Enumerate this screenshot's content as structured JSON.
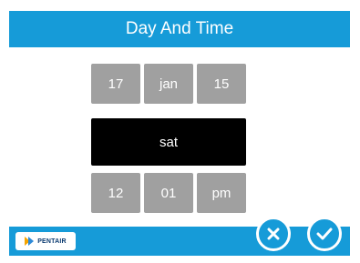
{
  "header": {
    "title": "Day And Time"
  },
  "date": {
    "day_of_month": "17",
    "month": "jan",
    "year": "15"
  },
  "weekday": "sat",
  "time": {
    "hour": "12",
    "minute": "01",
    "meridiem": "pm"
  },
  "footer": {
    "brand": "PENTAIR"
  },
  "actions": {
    "cancel_icon": "close-icon",
    "confirm_icon": "check-icon"
  },
  "colors": {
    "accent": "#169bd8",
    "tile": "#a0a0a0",
    "selected": "#000000"
  }
}
